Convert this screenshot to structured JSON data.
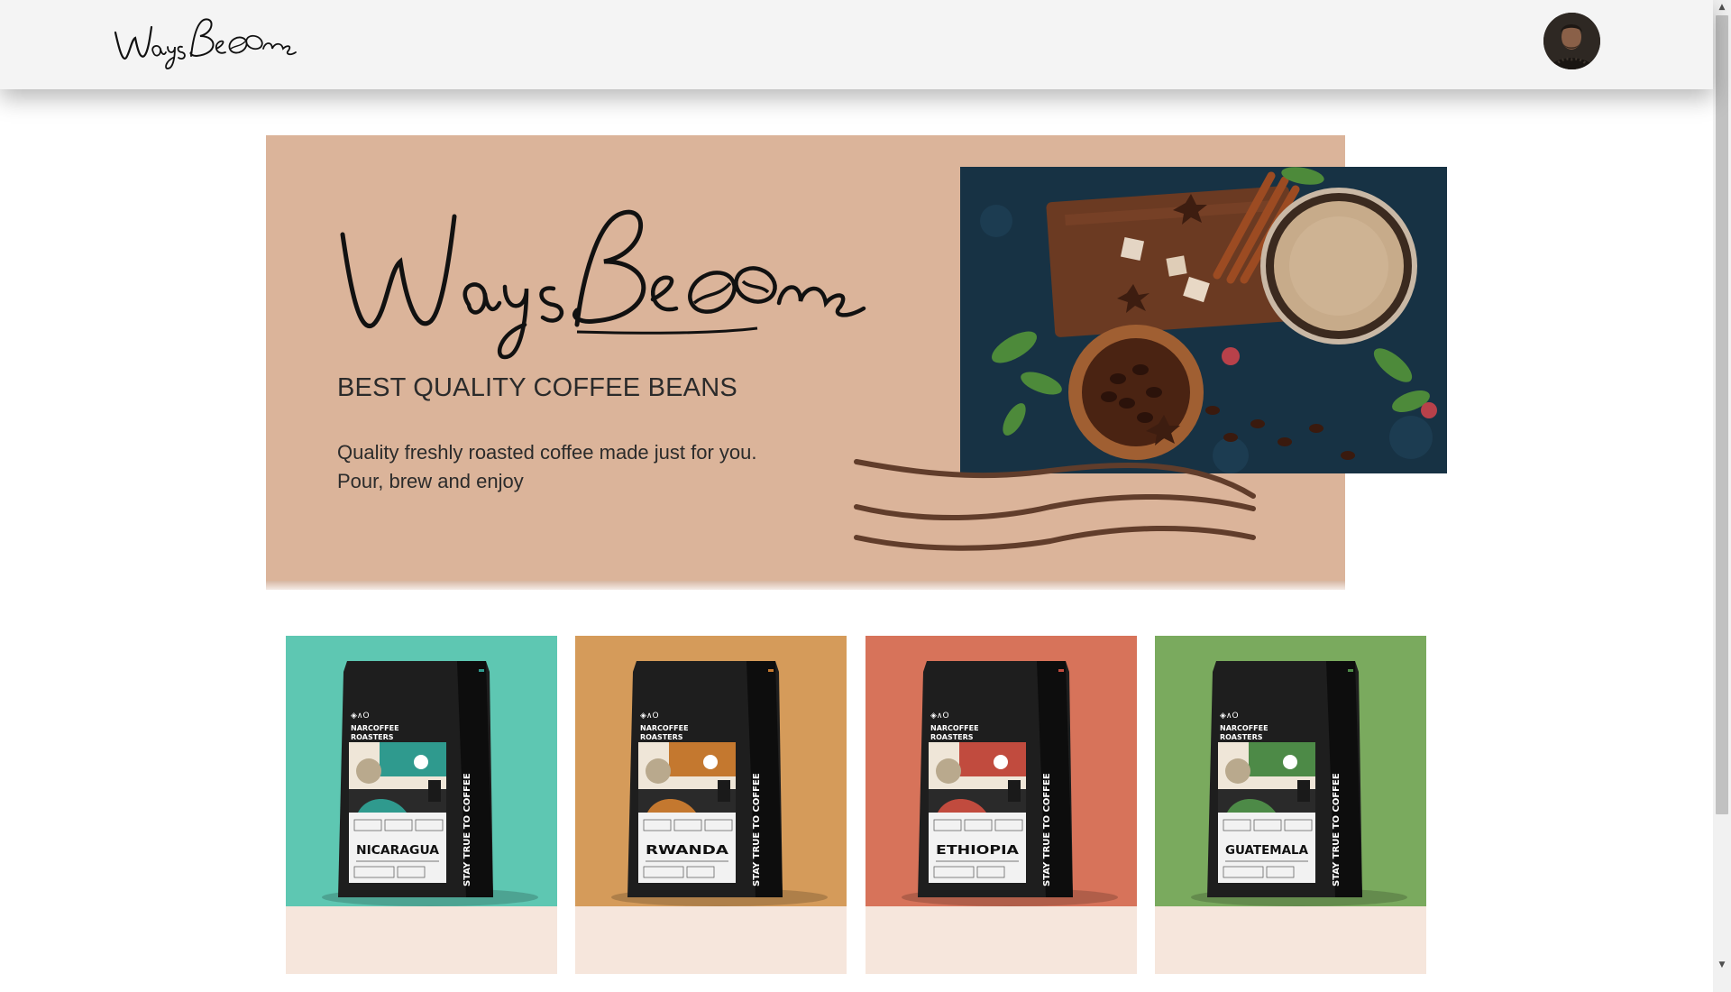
{
  "navbar": {
    "logo_text": "WaysBeans",
    "profile_avatar_alt": "User profile"
  },
  "hero": {
    "logo_text": "WaysBeans",
    "tagline": "BEST QUALITY COFFEE BEANS",
    "description_line1": "Quality freshly roasted coffee made just for you.",
    "description_line2": "Pour, brew and enjoy"
  },
  "products": [
    {
      "brand": "NARCOFFEE ROASTERS",
      "origin": "NICARAGUA",
      "side_text": "STAY TRUE TO COFFEE",
      "bg_color": "#5ec7b2",
      "accent_color": "#2f9a8e",
      "name": "",
      "price": ""
    },
    {
      "brand": "NARCOFFEE ROASTERS",
      "origin": "RWANDA",
      "side_text": "STAY TRUE TO COFFEE",
      "bg_color": "#d59b5a",
      "accent_color": "#c4782f",
      "name": "",
      "price": ""
    },
    {
      "brand": "NARCOFFEE ROASTERS",
      "origin": "ETHIOPIA",
      "side_text": "STAY TRUE TO COFFEE",
      "bg_color": "#d7735a",
      "accent_color": "#c14b3e",
      "name": "",
      "price": ""
    },
    {
      "brand": "NARCOFFEE ROASTERS",
      "origin": "GUATEMALA",
      "side_text": "STAY TRUE TO COFFEE",
      "bg_color": "#7aaa5e",
      "accent_color": "#4d8a47",
      "name": "",
      "price": ""
    }
  ],
  "colors": {
    "navbar_bg": "#f4f4f4",
    "hero_bg": "#dbb49a",
    "card_bottom_bg": "#f6e6dc",
    "wave_color": "#613d2b"
  }
}
